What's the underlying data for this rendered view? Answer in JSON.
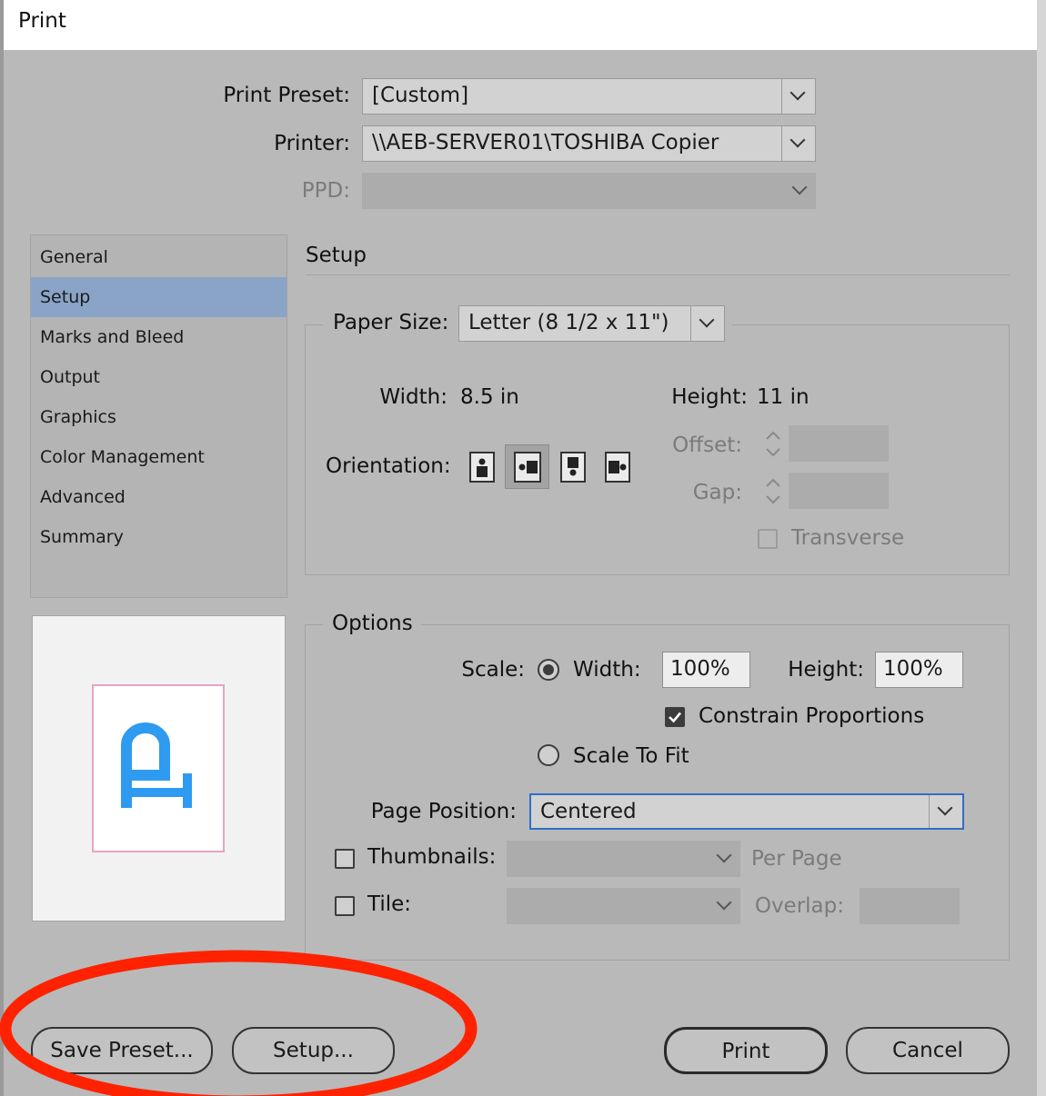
{
  "window": {
    "title": "Print"
  },
  "top": {
    "preset_label": "Print Preset:",
    "preset_value": "[Custom]",
    "printer_label": "Printer:",
    "printer_value": "\\\\AEB-SERVER01\\TOSHIBA Copier",
    "ppd_label": "PPD:",
    "ppd_value": ""
  },
  "nav": {
    "items": [
      {
        "label": "General"
      },
      {
        "label": "Setup"
      },
      {
        "label": "Marks and Bleed"
      },
      {
        "label": "Output"
      },
      {
        "label": "Graphics"
      },
      {
        "label": "Color Management"
      },
      {
        "label": "Advanced"
      },
      {
        "label": "Summary"
      }
    ],
    "selected": "Setup"
  },
  "preview": {
    "glyph": "P",
    "glyph_color": "#2e9bf0"
  },
  "setup": {
    "heading": "Setup",
    "paper_size_label": "Paper Size:",
    "paper_size_value": "Letter (8 1/2 x 11\")",
    "width_label": "Width:",
    "width_value": "8.5 in",
    "height_label": "Height:",
    "height_value": "11 in",
    "orientation_label": "Orientation:",
    "orientations": [
      "portrait",
      "landscape",
      "reverse-portrait",
      "reverse-landscape"
    ],
    "selected_orientation": "landscape",
    "offset_label": "Offset:",
    "gap_label": "Gap:",
    "transverse_label": "Transverse",
    "transverse_checked": false
  },
  "options": {
    "heading": "Options",
    "scale_label": "Scale:",
    "width_label": "Width:",
    "width_value": "100%",
    "height_label": "Height:",
    "height_value": "100%",
    "constrain_label": "Constrain Proportions",
    "constrain_checked": true,
    "scale_mode": "width-height",
    "scale_to_fit_label": "Scale To Fit",
    "page_position_label": "Page Position:",
    "page_position_value": "Centered",
    "thumbnails_label": "Thumbnails:",
    "thumbnails_checked": false,
    "per_page_label": "Per Page",
    "tile_label": "Tile:",
    "tile_checked": false,
    "overlap_label": "Overlap:"
  },
  "buttons": {
    "save_preset": "Save Preset...",
    "setup": "Setup...",
    "print": "Print",
    "cancel": "Cancel"
  },
  "annotation": {
    "color": "#ff2200",
    "shape": "ellipse"
  },
  "colors": {
    "dialog_bg": "#b9b9b9",
    "nav_selected": "#8aa4c8",
    "page_border": "#e4a4c4"
  }
}
